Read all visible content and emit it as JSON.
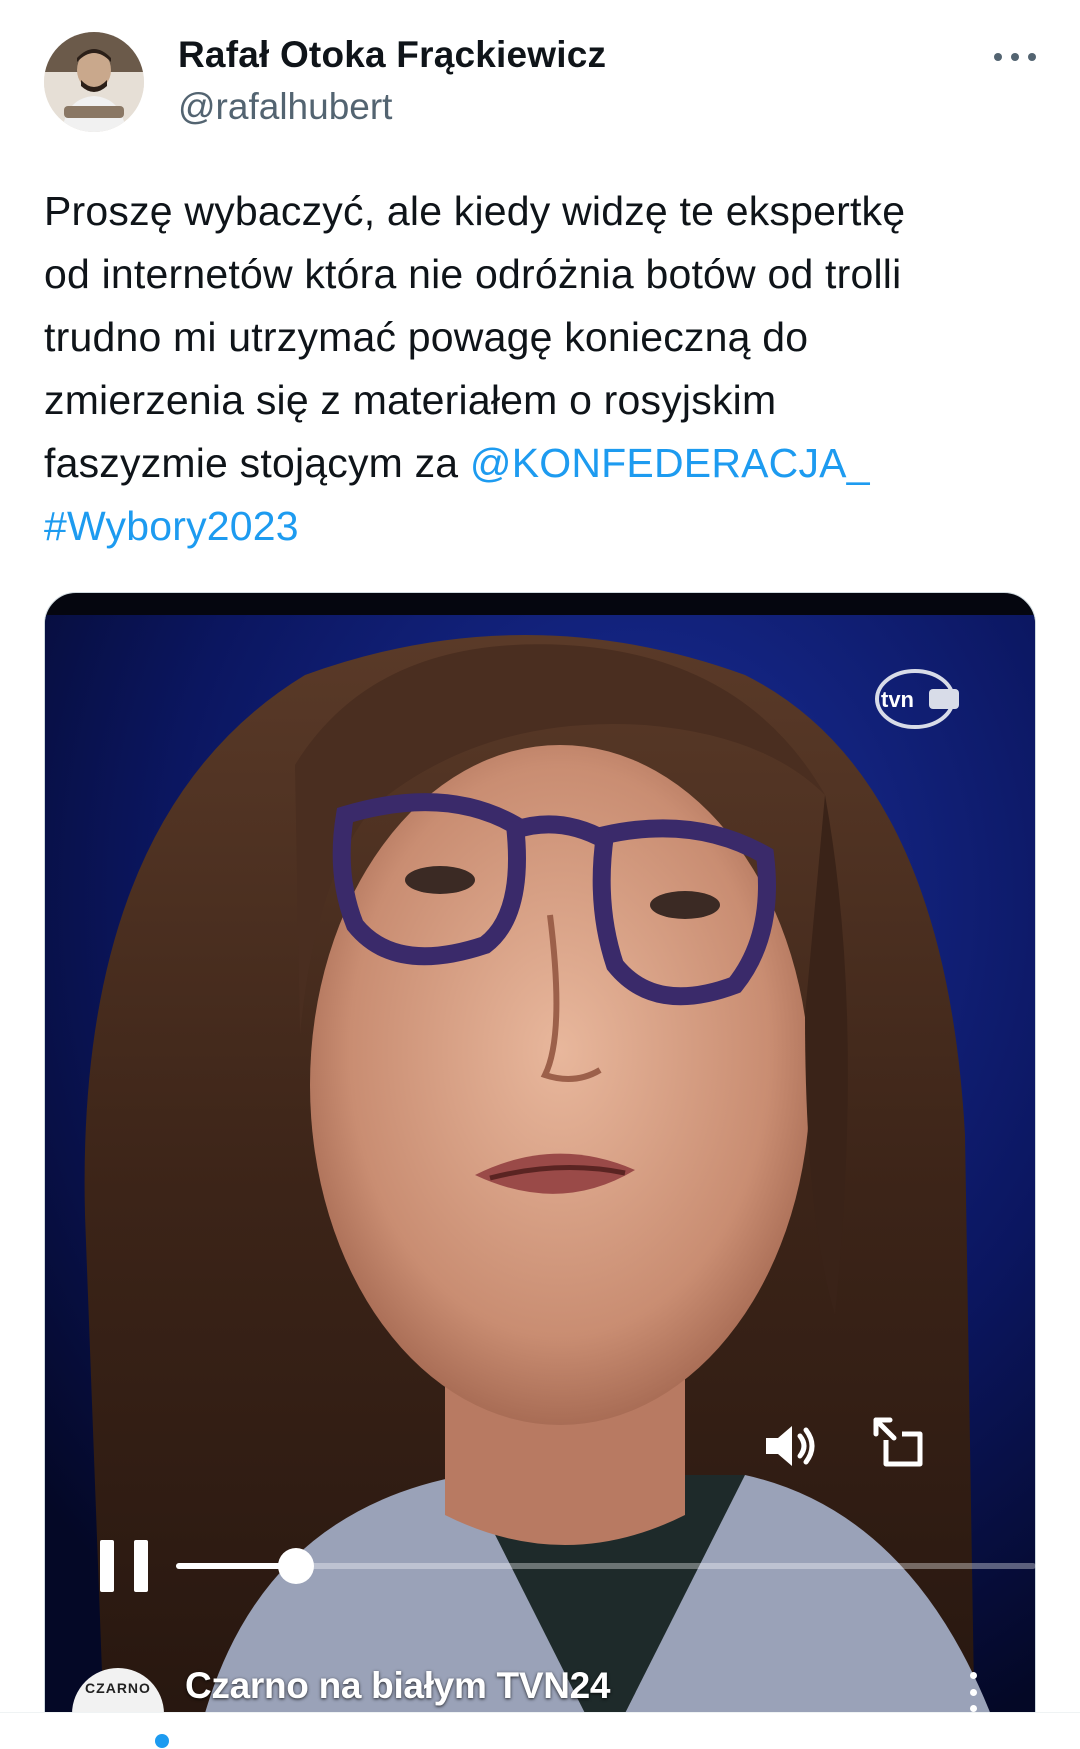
{
  "author": {
    "name": "Rafał Otoka Frąckiewicz",
    "handle": "@rafalhubert"
  },
  "tweet": {
    "lines": [
      "Proszę wybaczyć, ale kiedy widzę te ekspertkę",
      "od internetów która nie odróżnia botów od trolli",
      "trudno mi utrzymać powagę konieczną do",
      "zmierzenia się z materiałem o rosyjskim",
      "faszyzmie stojącym za "
    ],
    "mention": "@KONFEDERACJA_",
    "hashtag": "#Wybory2023"
  },
  "video": {
    "title": "Czarno na białym TVN24",
    "channel_badge": "CZARNO",
    "logo_text": "tvn",
    "progress_fraction": 0.14
  },
  "icons": {
    "more": "more-horizontal-icon",
    "volume": "volume-icon",
    "expand": "expand-icon",
    "pause": "pause-icon",
    "video_menu": "more-vertical-icon"
  },
  "colors": {
    "link": "#1d9bf0",
    "text": "#0f1419",
    "secondary": "#536471"
  }
}
